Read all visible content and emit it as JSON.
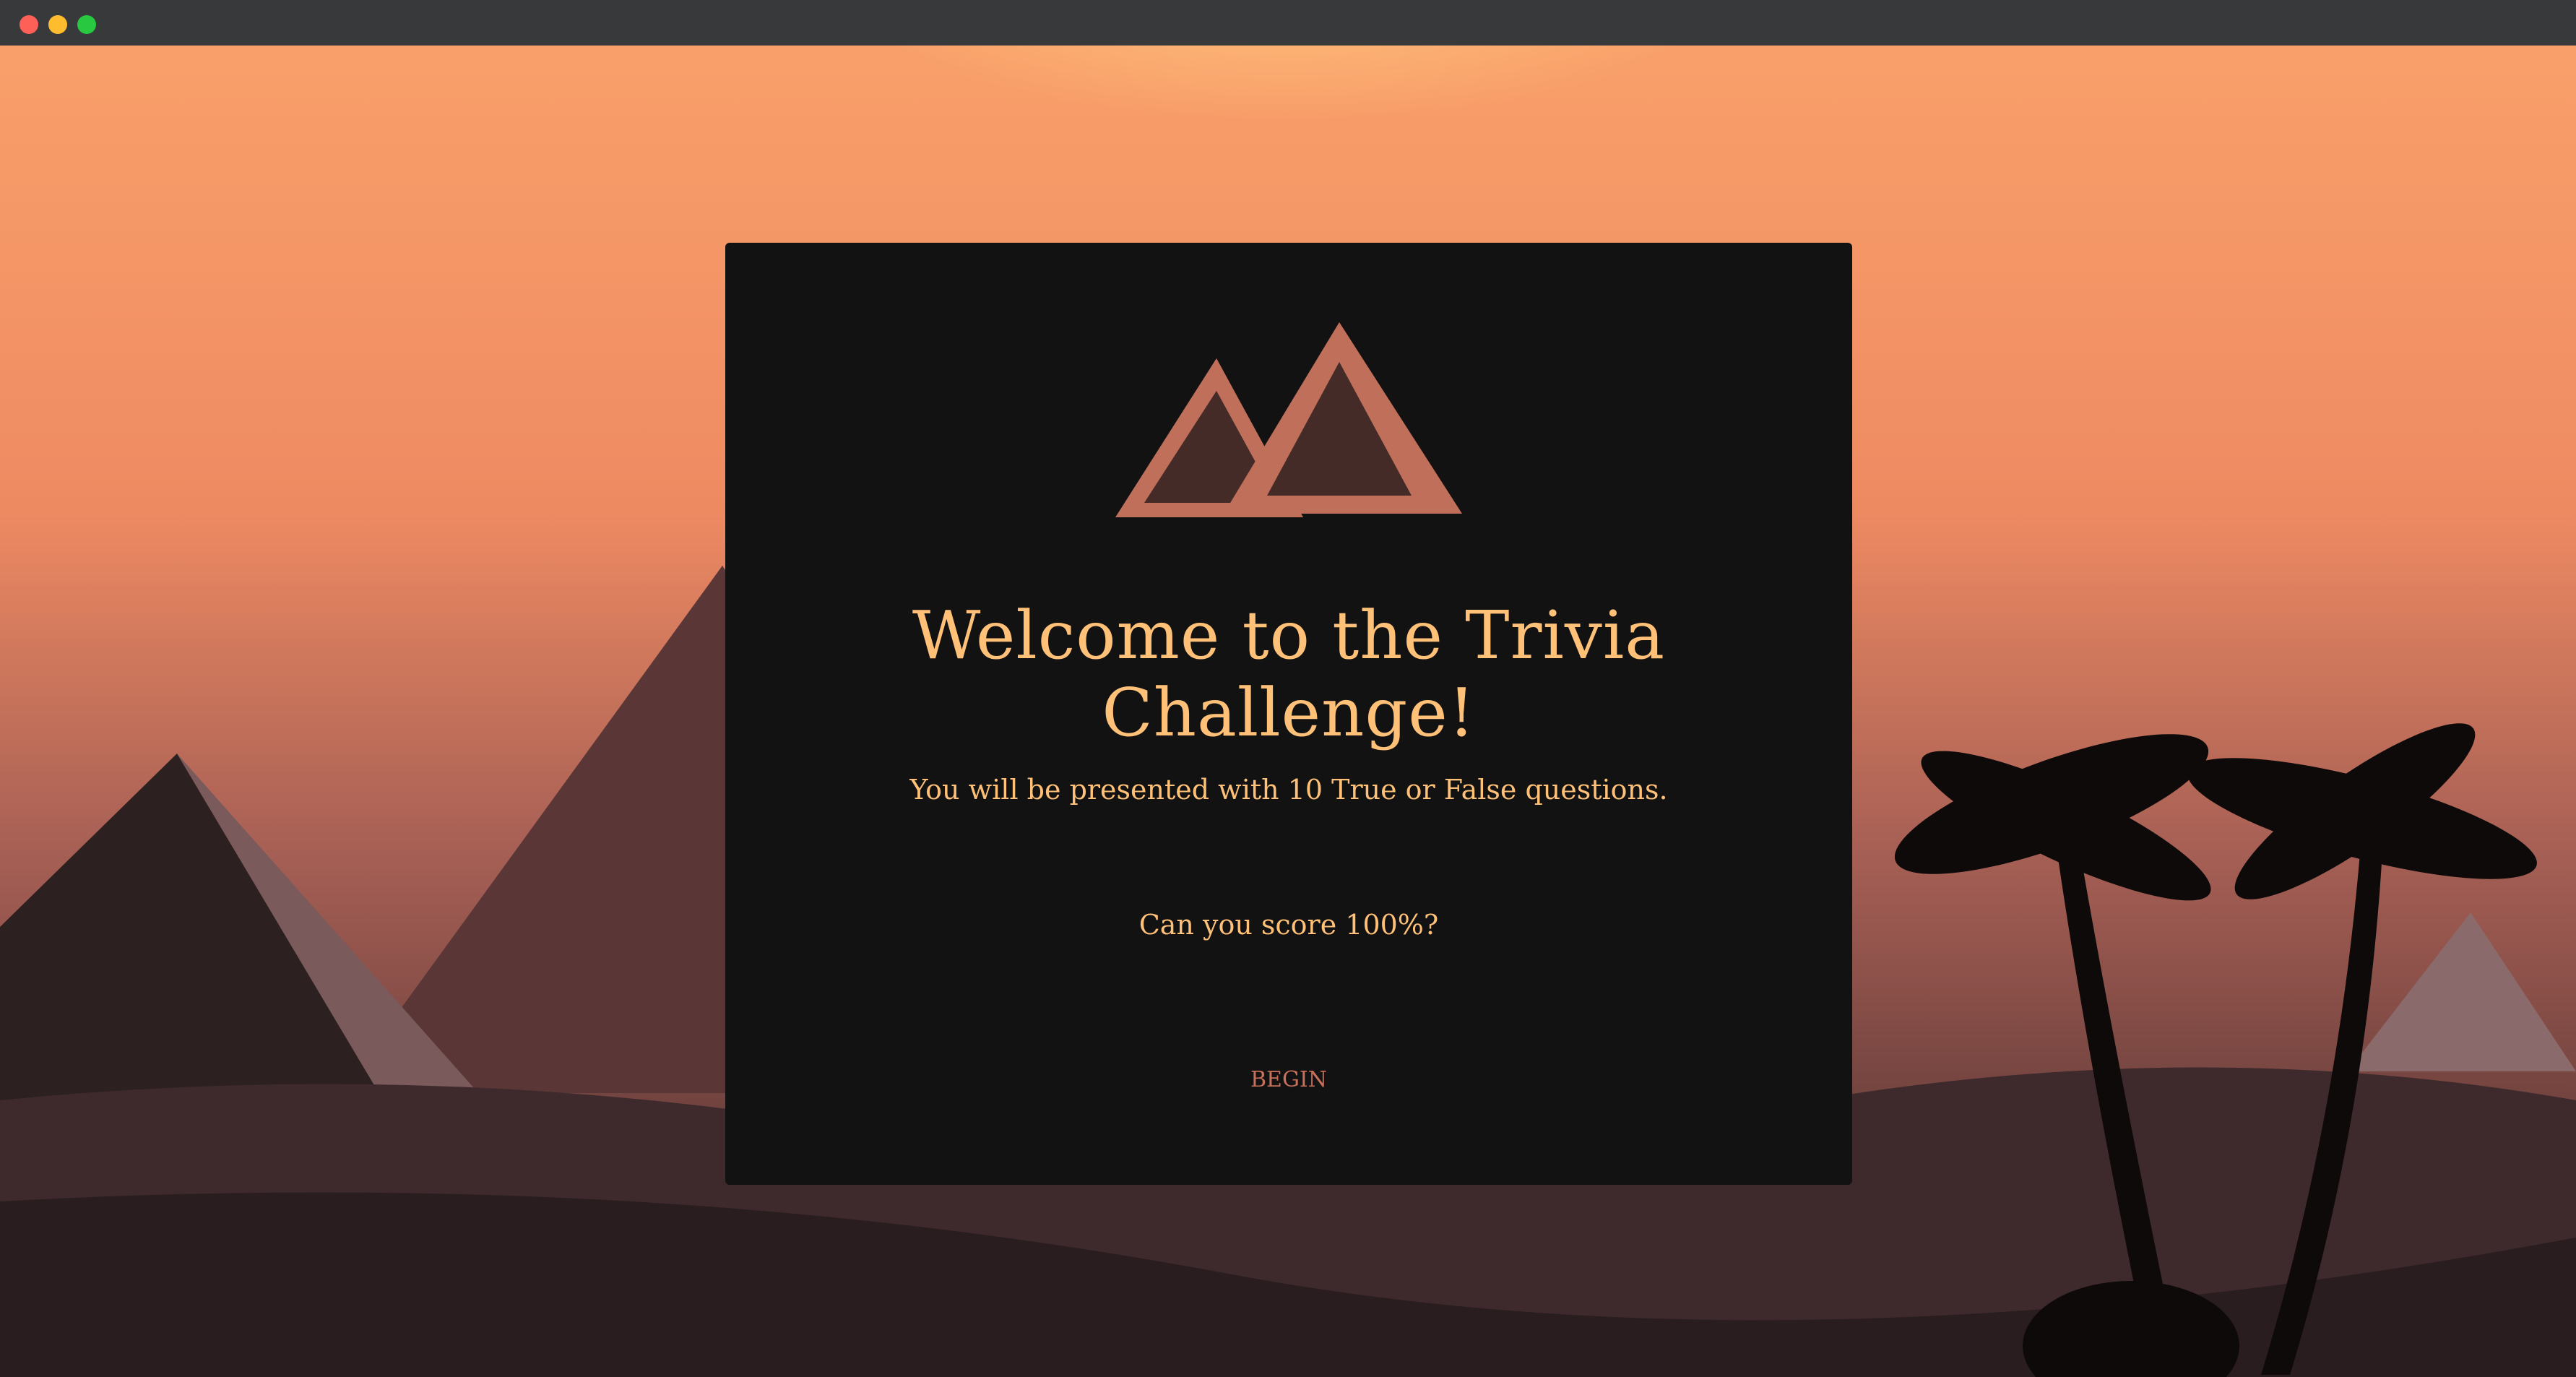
{
  "window": {
    "controls": [
      "close",
      "minimize",
      "maximize"
    ],
    "colors": {
      "close": "#fe5f57",
      "minimize": "#febc2e",
      "maximize": "#28c840"
    }
  },
  "welcome": {
    "logo": "pyramids-logo",
    "title": "Welcome to the Trivia Challenge!",
    "description": "You will be presented with 10 True or False questions.",
    "question": "Can you score 100%?",
    "begin_label": "BEGIN"
  },
  "colors": {
    "text": "#ffc178",
    "accent": "#c0705a",
    "card": "#121212"
  }
}
